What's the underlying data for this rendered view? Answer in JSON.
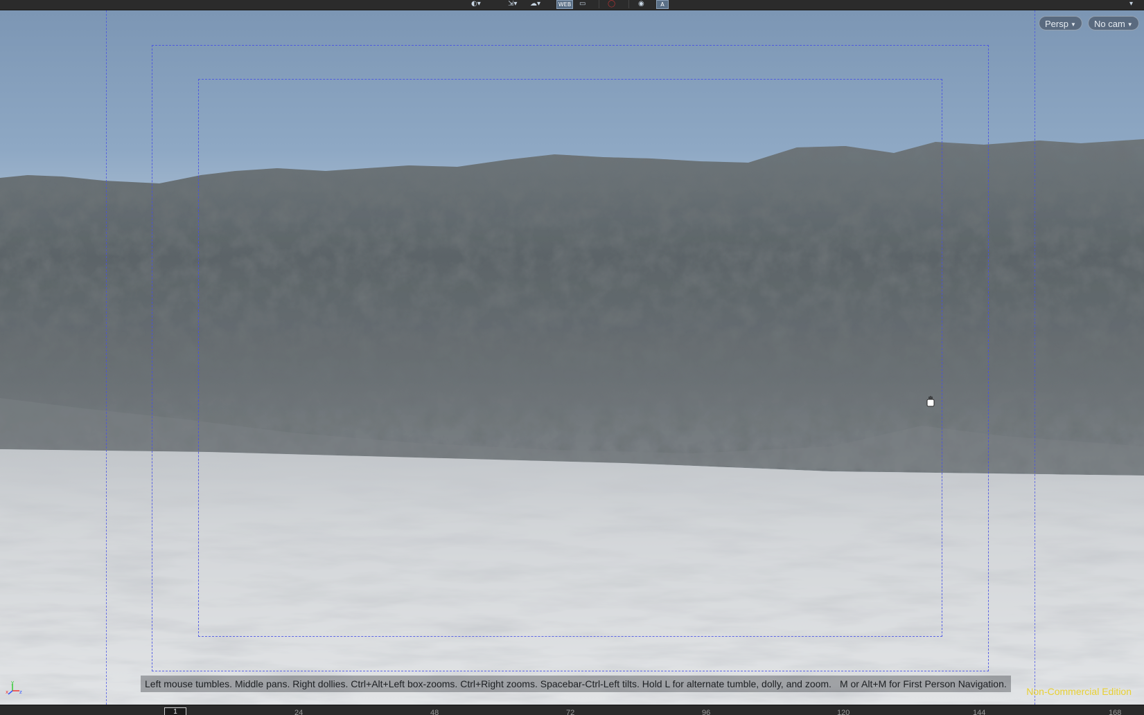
{
  "toolbar": {
    "icons": [
      "orbit-tool-icon",
      "handle-tool-icon",
      "render-tool-icon",
      "viewport-display-icon",
      "snapshot-icon",
      "record-icon",
      "sync-icon",
      "text-overlay-icon"
    ],
    "boxed_icon_label": "WEB",
    "text_icon_label": "A"
  },
  "viewport": {
    "persp_label": "Persp",
    "camera_label": "No cam",
    "help_text_part1": "Left mouse tumbles. Middle pans. Right dollies. Ctrl+Alt+Left box-zooms. Ctrl+Right zooms. Spacebar-Ctrl-Left tilts. Hold L for alternate tumble, dolly, and zoom.",
    "help_text_part2": "M or Alt+M for First Person Navigation.",
    "edition_label": "Non-Commercial Edition",
    "axis_labels": {
      "x": "x",
      "y": "y",
      "z": "z"
    },
    "guide_color": "#4650e6",
    "edition_color": "#e8d033"
  },
  "timeline": {
    "current_frame": "1",
    "ticks": [
      "24",
      "48",
      "72",
      "96",
      "120",
      "144",
      "168"
    ]
  }
}
